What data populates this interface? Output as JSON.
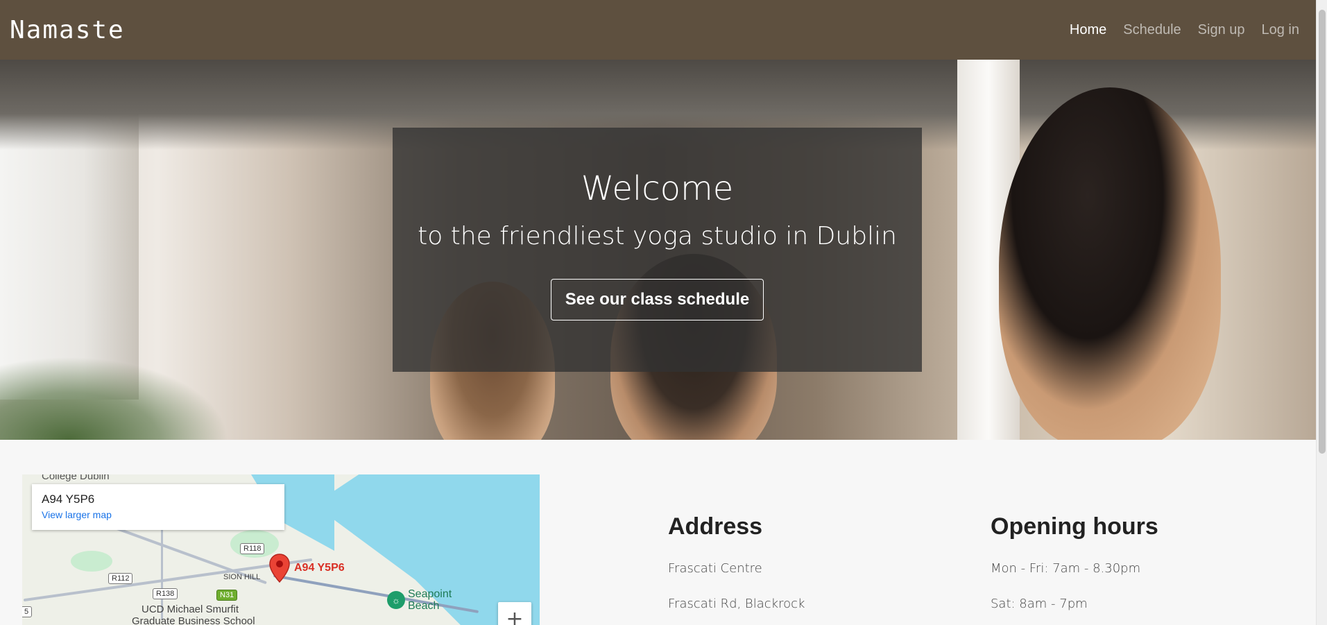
{
  "navbar": {
    "brand": "Namaste",
    "links": [
      {
        "label": "Home",
        "active": true
      },
      {
        "label": "Schedule",
        "active": false
      },
      {
        "label": "Sign up",
        "active": false
      },
      {
        "label": "Log in",
        "active": false
      }
    ]
  },
  "hero": {
    "title": "Welcome",
    "subtitle": "to the friendliest yoga studio in Dublin",
    "button_label": "See our class schedule"
  },
  "map": {
    "card_title": "A94 Y5P6",
    "card_link": "View larger map",
    "pin_label": "A94 Y5P6",
    "top_label": "College Dublin",
    "labels": {
      "sion_hill": "SION HILL",
      "ucd": "UCD Michael Smurfit",
      "ucd2": "Graduate Business School",
      "seapoint": "Seapoint",
      "beach": "Beach"
    },
    "shields": {
      "r118": "R118",
      "r112": "R112",
      "r138": "R138",
      "n31": "N31",
      "five": "5"
    },
    "zoom_in": "+",
    "icons": [
      "map-pin-icon",
      "beach-icon",
      "school-icon",
      "transit-icon",
      "zoom-in-icon"
    ]
  },
  "address": {
    "heading": "Address",
    "lines": [
      "Frascati Centre",
      "Frascati Rd, Blackrock"
    ]
  },
  "hours": {
    "heading": "Opening hours",
    "lines": [
      "Mon - Fri: 7am - 8.30pm",
      "Sat: 8am - 7pm"
    ]
  },
  "colors": {
    "navbar_bg": "#5e503f",
    "overlay_bg": "rgba(50,50,50,0.78)",
    "page_bg": "#f7f7f7",
    "map_link": "#1a73e8",
    "map_pin": "#d93025"
  }
}
